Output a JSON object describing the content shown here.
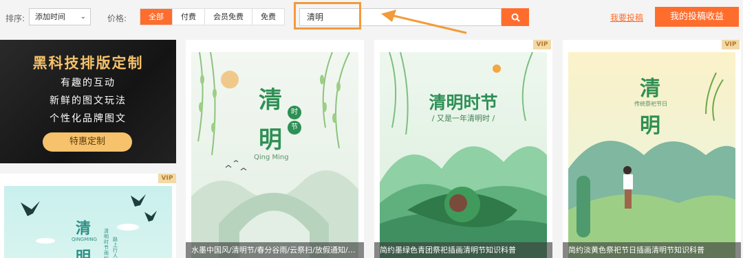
{
  "toolbar": {
    "sort_label": "排序:",
    "sort_value": "添加时间",
    "price_label": "价格:",
    "price_tabs": [
      "全部",
      "付费",
      "会员免费",
      "免费"
    ],
    "search_value": "清明",
    "link_contribute": "我要投稿",
    "earnings_button": "我的投稿收益"
  },
  "promo": {
    "title": "黑科技排版定制",
    "lines": [
      "有趣的互动",
      "新鲜的图文玩法",
      "个性化品牌图文"
    ],
    "button": "特惠定制"
  },
  "cards": [
    {
      "caption": "水墨中国风/清明节/春分谷雨/云祭扫/放假通知/…",
      "art": {
        "char1": "清",
        "char2": "明",
        "seal_top": "时",
        "seal_bottom": "节",
        "subtitle": "Qing Ming"
      }
    },
    {
      "vip": "VIP",
      "caption": "简约墨绿色青团祭祀插画清明节知识科普",
      "art": {
        "title": "清明时节",
        "subtitle": "/ 又是一年清明时 /"
      }
    },
    {
      "vip": "VIP",
      "caption": "简约淡黄色祭祀节日插画清明节知识科普",
      "art": {
        "char1": "清",
        "char2": "明",
        "subtitle": "传统祭祀节日"
      }
    },
    {
      "vip": "VIP",
      "art": {
        "char1": "清",
        "char2": "明",
        "latin": "QINGMING",
        "vertical1": "清明时节雨纷纷",
        "vertical2": "路上行人"
      }
    }
  ]
}
